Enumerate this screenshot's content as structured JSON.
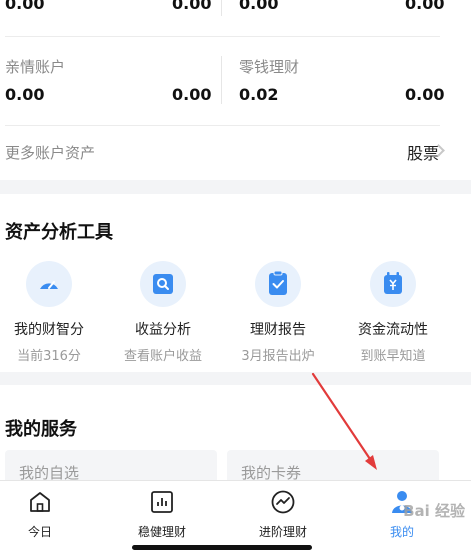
{
  "accounts": {
    "top_row": {
      "a_left": "0.00",
      "a_right": "0.00",
      "b_left": "0.00",
      "b_right": "0.00"
    },
    "family": {
      "label": "亲情账户",
      "left": "0.00",
      "right": "0.00"
    },
    "change": {
      "label": "零钱理财",
      "left": "0.02",
      "right": "0.00"
    },
    "more": {
      "label": "更多账户资产",
      "right_label": "股票"
    }
  },
  "tools": {
    "title": "资产分析工具",
    "items": [
      {
        "name": "我的财智分",
        "sub": "当前316分",
        "icon": "gauge-icon"
      },
      {
        "name": "收益分析",
        "sub": "查看账户收益",
        "icon": "magnifier-icon"
      },
      {
        "name": "理财报告",
        "sub": "3月报告出炉",
        "icon": "clipboard-check-icon"
      },
      {
        "name": "资金流动性",
        "sub": "到账早知道",
        "icon": "calendar-yuan-icon"
      }
    ]
  },
  "services": {
    "title": "我的服务",
    "boxes": [
      "我的自选",
      "我的卡券"
    ]
  },
  "tabbar": {
    "items": [
      {
        "label": "今日",
        "icon": "home-icon"
      },
      {
        "label": "稳健理财",
        "icon": "chart-icon"
      },
      {
        "label": "进阶理财",
        "icon": "trend-icon"
      },
      {
        "label": "我的",
        "icon": "profile-icon"
      }
    ]
  },
  "watermark": "Bai 经验",
  "colors": {
    "accent": "#3a8cf0",
    "icon_bg": "#e8f1fc",
    "arrow": "#e23b3b"
  }
}
